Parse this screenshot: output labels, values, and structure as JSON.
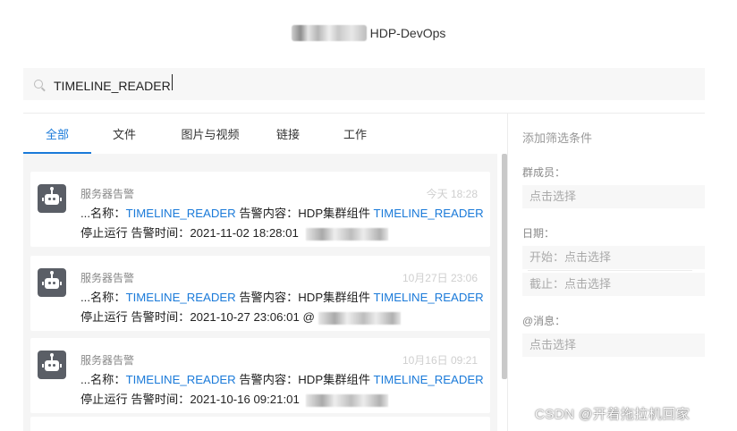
{
  "window": {
    "title": "HDP-DevOps"
  },
  "search": {
    "value": "TIMELINE_READER"
  },
  "tabs": [
    {
      "label": "全部",
      "active": true
    },
    {
      "label": "文件",
      "active": false
    },
    {
      "label": "图片与视频",
      "active": false
    },
    {
      "label": "链接",
      "active": false
    },
    {
      "label": "工作",
      "active": false
    }
  ],
  "messages": [
    {
      "sender": "服务器告警",
      "time": "今天 18:28",
      "line1_pre": "...名称：",
      "line1_hl1": "TIMELINE_READER",
      "line1_mid": " 告警内容：HDP集群组件 ",
      "line1_hl2": "TIMELINE_READER",
      "line2": "停止运行 告警时间：2021-11-02 18:28:01 "
    },
    {
      "sender": "服务器告警",
      "time": "10月27日 23:06",
      "line1_pre": "...名称：",
      "line1_hl1": "TIMELINE_READER",
      "line1_mid": " 告警内容：HDP集群组件 ",
      "line1_hl2": "TIMELINE_READER",
      "line2": "停止运行 告警时间：2021-10-27 23:06:01 @"
    },
    {
      "sender": "服务器告警",
      "time": "10月16日 09:21",
      "line1_pre": "...名称：",
      "line1_hl1": "TIMELINE_READER",
      "line1_mid": " 告警内容：HDP集群组件 ",
      "line1_hl2": "TIMELINE_READER",
      "line2": "停止运行 告警时间：2021-10-16 09:21:01 "
    }
  ],
  "filters": {
    "title": "添加筛选条件",
    "members_label": "群成员：",
    "members_placeholder": "点击选择",
    "date_label": "日期：",
    "start_placeholder": "开始：点击选择",
    "end_placeholder": "截止：点击选择",
    "mention_label": "@消息：",
    "mention_placeholder": "点击选择"
  },
  "watermark": "CSDN @开着拖拉机回家",
  "colors": {
    "accent": "#1a7ad9",
    "avatar_bg": "#5a5e66"
  },
  "icons": {
    "search": "search-icon",
    "avatar": "robot-icon"
  }
}
